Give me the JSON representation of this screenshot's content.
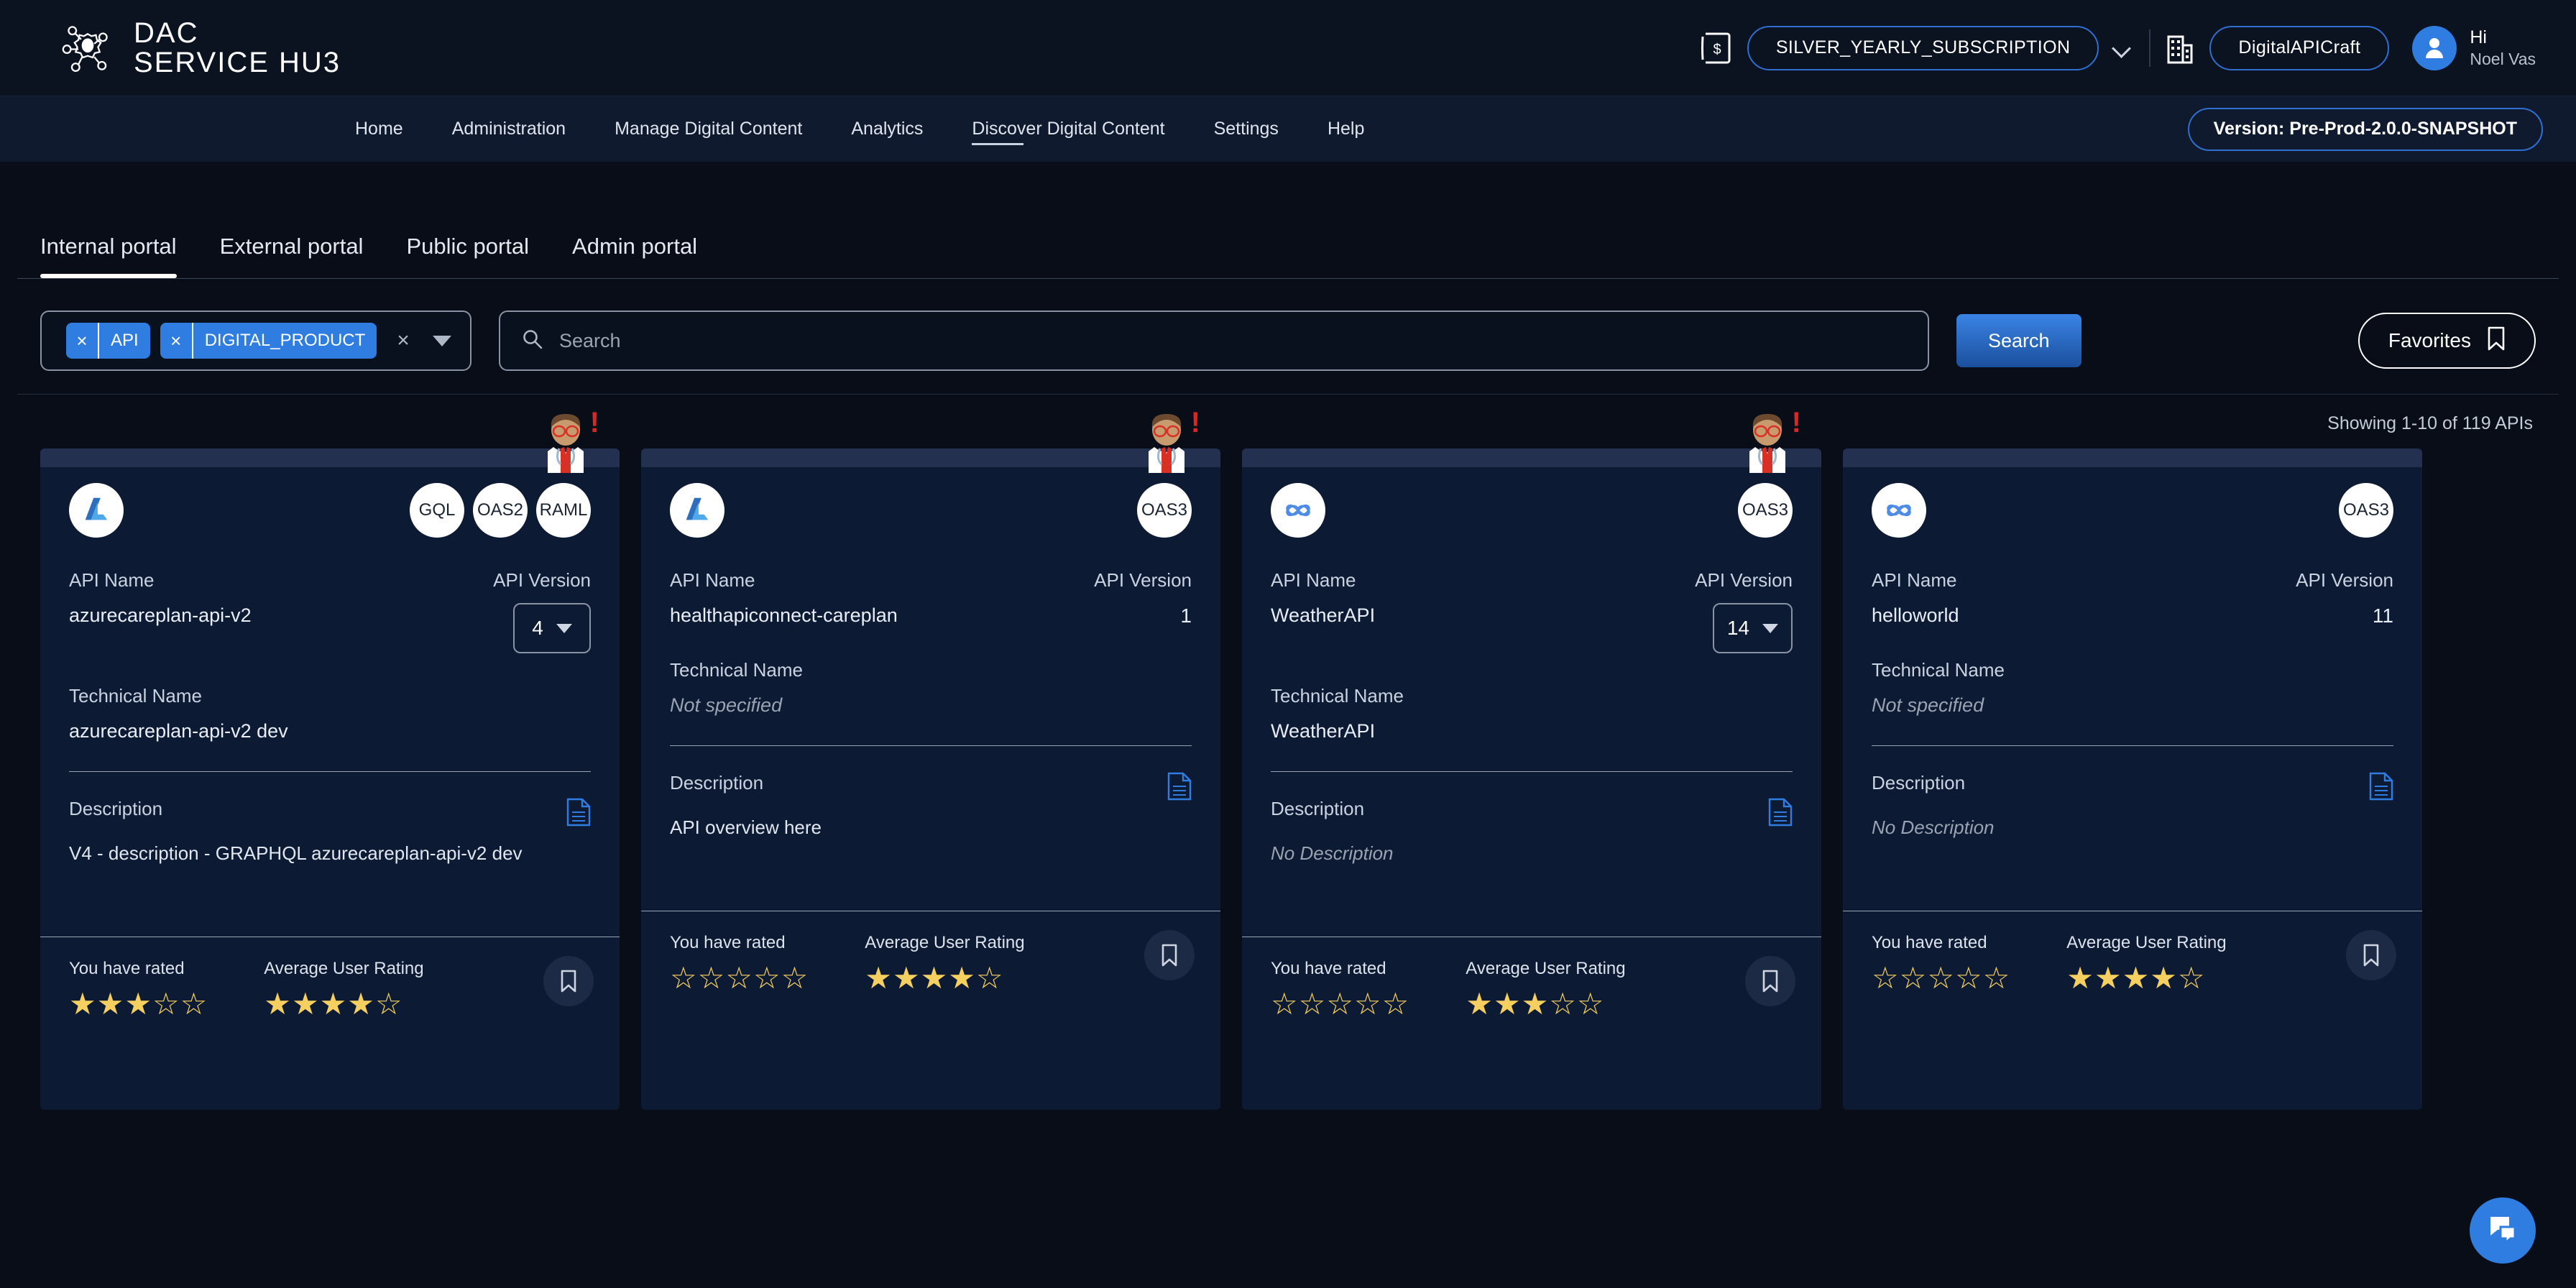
{
  "header": {
    "brand_line1": "DAC",
    "brand_line2": "SERVICE HU3",
    "subscription": "SILVER_YEARLY_SUBSCRIPTION",
    "organization": "DigitalAPICraft",
    "greeting": "Hi",
    "user_name": "Noel Vas"
  },
  "nav": {
    "items": [
      {
        "label": "Home",
        "active": false
      },
      {
        "label": "Administration",
        "active": false
      },
      {
        "label": "Manage Digital Content",
        "active": false
      },
      {
        "label": "Analytics",
        "active": false
      },
      {
        "label": "Discover Digital Content",
        "active": true
      },
      {
        "label": "Settings",
        "active": false
      },
      {
        "label": "Help",
        "active": false
      }
    ],
    "version_badge": "Version: Pre-Prod-2.0.0-SNAPSHOT"
  },
  "portal_tabs": [
    {
      "label": "Internal portal",
      "active": true
    },
    {
      "label": "External portal",
      "active": false
    },
    {
      "label": "Public portal",
      "active": false
    },
    {
      "label": "Admin portal",
      "active": false
    }
  ],
  "filters": {
    "chips": [
      {
        "label": "API"
      },
      {
        "label": "DIGITAL_PRODUCT"
      }
    ],
    "clear_all": "×",
    "search_placeholder": "Search",
    "search_value": "",
    "search_button": "Search",
    "favorites_button": "Favorites"
  },
  "results": {
    "showing": "Showing 1-10 of 119 APIs"
  },
  "card_labels": {
    "api_name": "API Name",
    "api_version": "API Version",
    "technical_name": "Technical Name",
    "description": "Description",
    "you_have_rated": "You have rated",
    "average_user_rating": "Average User Rating"
  },
  "cards": [
    {
      "logo": "azure-logo",
      "badges": [
        "GQL",
        "OAS2",
        "RAML"
      ],
      "api_name": "azurecareplan-api-v2",
      "api_version": "4",
      "version_is_select": true,
      "technical_name": "azurecareplan-api-v2 dev",
      "technical_name_muted": false,
      "description": "V4 - description - GRAPHQL azurecareplan-api-v2 dev",
      "description_muted": false,
      "user_rating": 3,
      "average_rating": 4,
      "has_avatar": true
    },
    {
      "logo": "azure-logo",
      "badges": [
        "OAS3"
      ],
      "api_name": "healthapiconnect-careplan",
      "api_version": "1",
      "version_is_select": false,
      "technical_name": "Not specified",
      "technical_name_muted": true,
      "description": "API overview here",
      "description_muted": false,
      "user_rating": 0,
      "average_rating": 4,
      "has_avatar": true
    },
    {
      "logo": "atom-logo",
      "badges": [
        "OAS3"
      ],
      "api_name": "WeatherAPI",
      "api_version": "14",
      "version_is_select": true,
      "technical_name": "WeatherAPI",
      "technical_name_muted": false,
      "description": "No Description",
      "description_muted": true,
      "user_rating": 0,
      "average_rating": 3,
      "has_avatar": true
    },
    {
      "logo": "atom-logo",
      "badges": [
        "OAS3"
      ],
      "api_name": "helloworld",
      "api_version": "11",
      "version_is_select": false,
      "technical_name": "Not specified",
      "technical_name_muted": true,
      "description": "No Description",
      "description_muted": true,
      "user_rating": 0,
      "average_rating": 4,
      "has_avatar": false
    }
  ],
  "colors": {
    "accent_blue": "#2f7de1",
    "page_bg": "#080d17",
    "card_bg": "#0d1a33",
    "star": "#f5cf5f",
    "alert_red": "#e02424"
  }
}
